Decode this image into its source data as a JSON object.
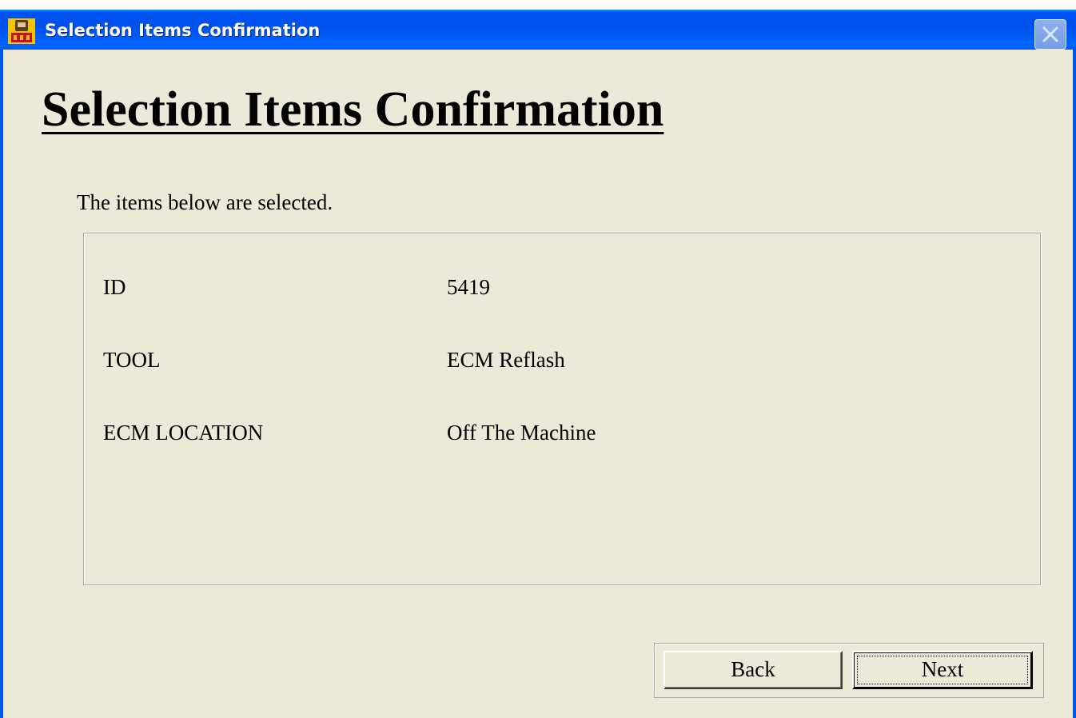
{
  "window": {
    "title": "Selection Items Confirmation",
    "icon": "bts-app-icon",
    "close_icon": "close-icon"
  },
  "heading": "Selection Items Confirmation",
  "intro": "The items below are selected.",
  "items": [
    {
      "label": "ID",
      "value": "5419"
    },
    {
      "label": "TOOL",
      "value": "ECM Reflash"
    },
    {
      "label": "ECM LOCATION",
      "value": "Off The Machine"
    }
  ],
  "buttons": {
    "back": "Back",
    "next": "Next"
  },
  "colors": {
    "titlebar": "#0054e3",
    "dialog_background": "#ece9d8"
  }
}
